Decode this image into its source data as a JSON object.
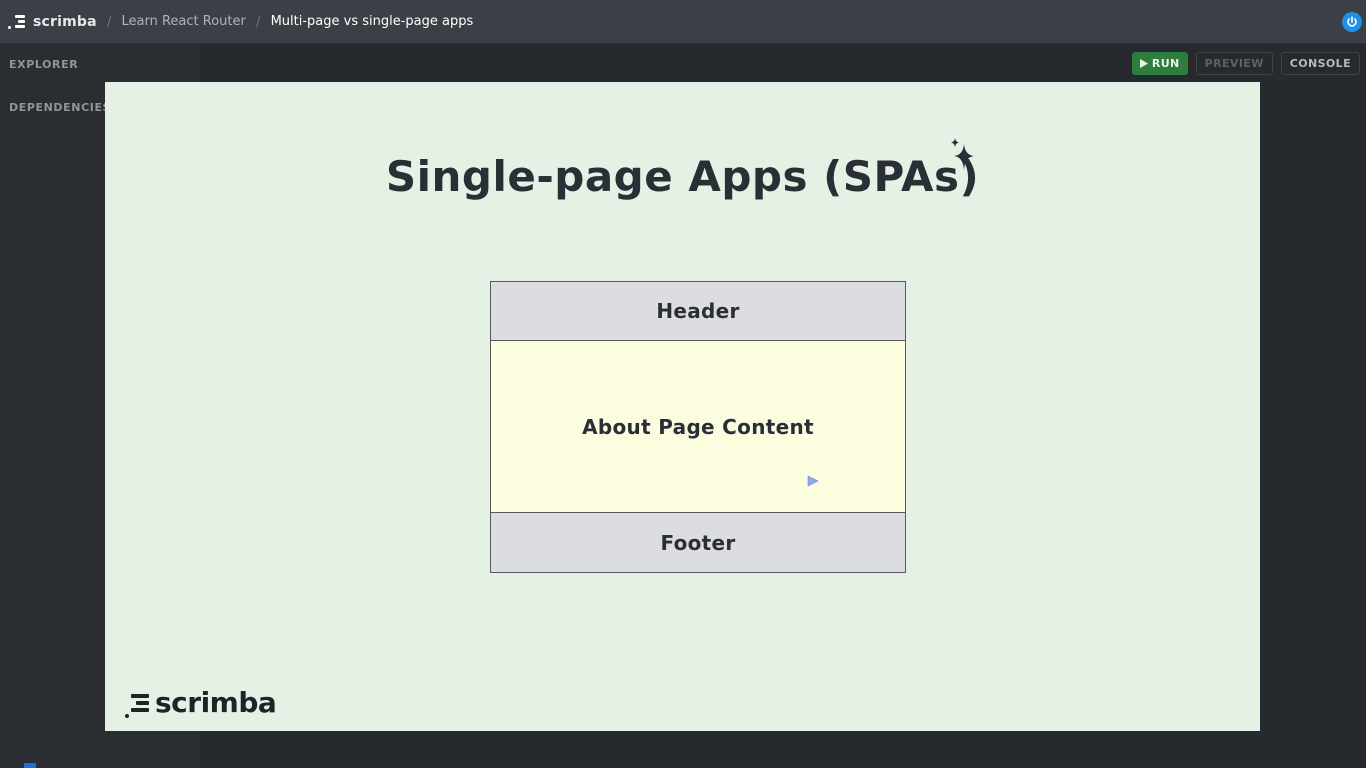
{
  "topbar": {
    "brand": "scrimba",
    "breadcrumbs": [
      "Learn React Router",
      "Multi-page vs single-page apps"
    ],
    "separator": "/",
    "power_icon": "power-icon"
  },
  "sidebar": {
    "items": [
      {
        "label": "EXPLORER"
      },
      {
        "label": "DEPENDENCIES"
      }
    ]
  },
  "toolbar": {
    "run_label": "RUN",
    "preview_label": "PREVIEW",
    "console_label": "CONSOLE"
  },
  "slide": {
    "title": "Single-page Apps (SPAs)",
    "header_label": "Header",
    "content_label": "About Page Content",
    "footer_label": "Footer",
    "logo_text": "scrimba"
  },
  "colors": {
    "slide_bg": "#e6f1e6",
    "header_footer_bg": "#dcdde0",
    "content_bg": "#fdfde0",
    "run_button": "#2e7d3a",
    "accent_blue": "#1e90e6"
  }
}
